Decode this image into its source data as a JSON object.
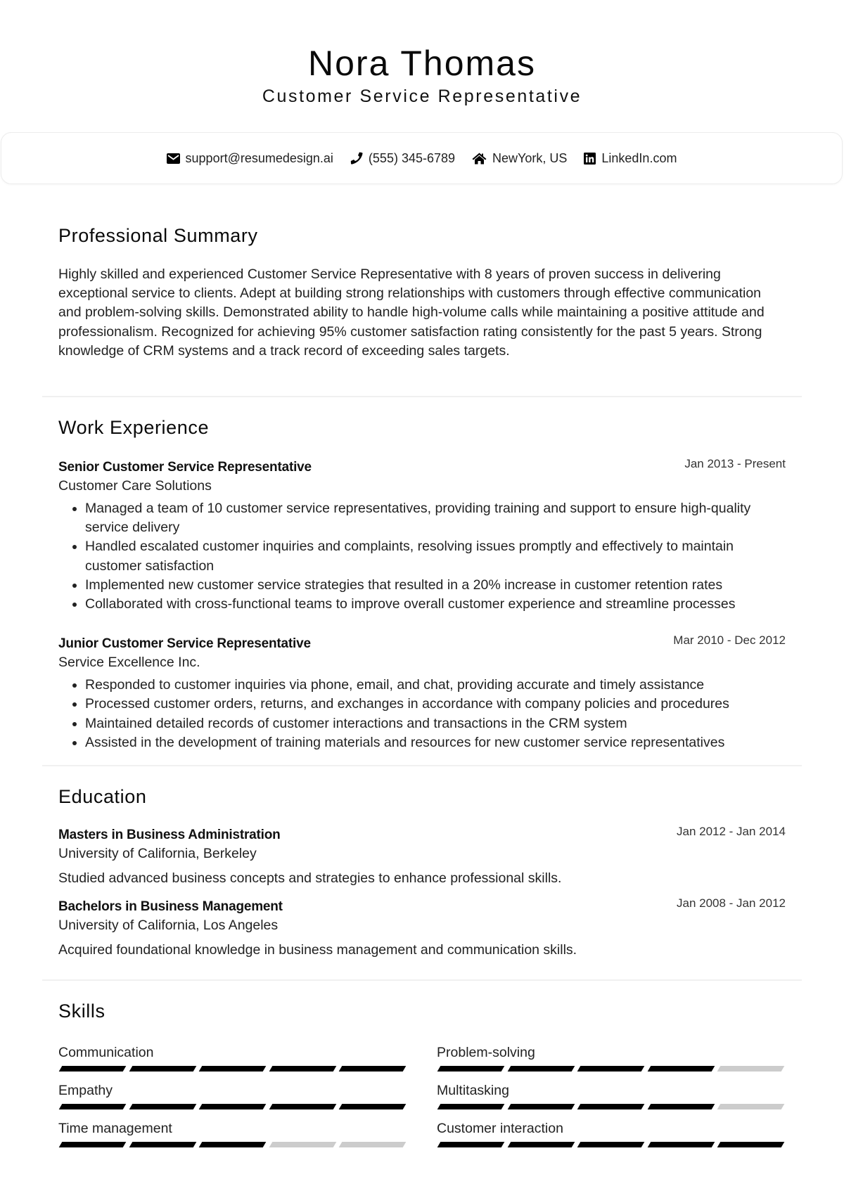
{
  "header": {
    "name": "Nora Thomas",
    "title": "Customer Service Representative"
  },
  "contact": {
    "email": {
      "icon": "envelope-icon",
      "text": "support@resumedesign.ai"
    },
    "phone": {
      "icon": "phone-icon",
      "text": "(555) 345-6789"
    },
    "location": {
      "icon": "home-icon",
      "text": "NewYork, US"
    },
    "linkedin": {
      "icon": "linkedin-icon",
      "text": "LinkedIn.com"
    }
  },
  "summary": {
    "heading": "Professional Summary",
    "text": "Highly skilled and experienced Customer Service Representative with 8 years of proven success in delivering exceptional service to clients. Adept at building strong relationships with customers through effective communication and problem-solving skills. Demonstrated ability to handle high-volume calls while maintaining a positive attitude and professionalism. Recognized for achieving 95% customer satisfaction rating consistently for the past 5 years. Strong knowledge of CRM systems and a track record of exceeding sales targets."
  },
  "work": {
    "heading": "Work Experience",
    "jobs": [
      {
        "title": "Senior Customer Service Representative",
        "date": "Jan 2013 - Present",
        "company": "Customer Care Solutions",
        "bullets": [
          "Managed a team of 10 customer service representatives, providing training and support to ensure high-quality service delivery",
          "Handled escalated customer inquiries and complaints, resolving issues promptly and effectively to maintain customer satisfaction",
          "Implemented new customer service strategies that resulted in a 20% increase in customer retention rates",
          "Collaborated with cross-functional teams to improve overall customer experience and streamline processes"
        ]
      },
      {
        "title": "Junior Customer Service Representative",
        "date": "Mar 2010 - Dec 2012",
        "company": "Service Excellence Inc.",
        "bullets": [
          "Responded to customer inquiries via phone, email, and chat, providing accurate and timely assistance",
          "Processed customer orders, returns, and exchanges in accordance with company policies and procedures",
          "Maintained detailed records of customer interactions and transactions in the CRM system",
          "Assisted in the development of training materials and resources for new customer service representatives"
        ]
      }
    ]
  },
  "education": {
    "heading": "Education",
    "items": [
      {
        "degree": "Masters in Business Administration",
        "date": "Jan 2012 - Jan 2014",
        "school": "University of California, Berkeley",
        "description": "Studied advanced business concepts and strategies to enhance professional skills."
      },
      {
        "degree": "Bachelors in Business Management",
        "date": "Jan 2008 - Jan 2012",
        "school": "University of California, Los Angeles",
        "description": "Acquired foundational knowledge in business management and communication skills."
      }
    ]
  },
  "skills": {
    "heading": "Skills",
    "max_rating": 5,
    "items": [
      {
        "name": "Communication",
        "rating": 5
      },
      {
        "name": "Problem-solving",
        "rating": 4
      },
      {
        "name": "Empathy",
        "rating": 5
      },
      {
        "name": "Multitasking",
        "rating": 4
      },
      {
        "name": "Time management",
        "rating": 3
      },
      {
        "name": "Customer interaction",
        "rating": 5
      }
    ]
  },
  "colors": {
    "filled_segment": "#000000",
    "empty_segment": "#cccccc",
    "divider": "#f0f0f0"
  }
}
